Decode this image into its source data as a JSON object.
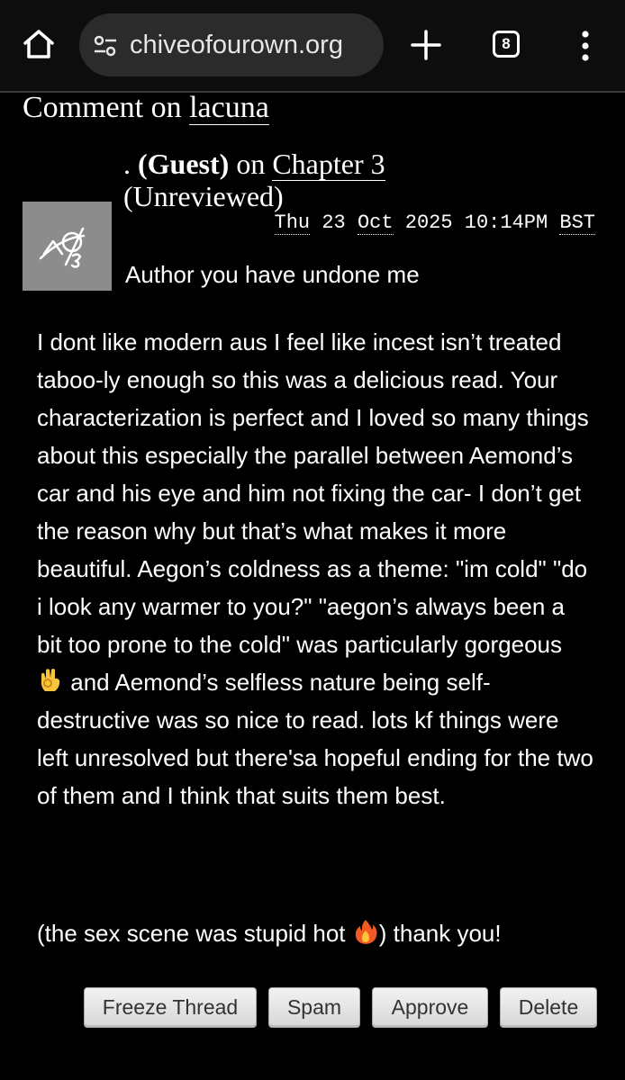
{
  "browser": {
    "url": "chiveofourown.org",
    "tab_count": "8",
    "icons": [
      "home-icon",
      "site-settings-icon",
      "new-tab-icon",
      "tab-switcher-icon",
      "more-options-icon"
    ]
  },
  "page": {
    "heading_prefix": "Comment on",
    "work_title": "lacuna"
  },
  "comment": {
    "author_prefix": ".",
    "author": "(Guest)",
    "on_text": "on",
    "chapter": "Chapter 3",
    "status": "(Unreviewed)",
    "date": {
      "day": "Thu",
      "date_num": "23",
      "month": "Oct",
      "year": "2025",
      "time": "10:14PM",
      "tz": "BST"
    },
    "first_line": "Author you have undone me",
    "body_part1": "I dont like modern aus I feel like incest isn’t treated taboo-ly enough so this was a delicious read. Your characterization is perfect and I loved so many things about this especially the parallel between Aemond’s car and his eye and him not fixing the car- I don’t get the reason why but that’s what makes it more beautiful. Aegon’s coldness as a theme: \"im cold\" \"do i look any warmer to you?\" \"aegon’s always been a bit too prone to the cold\" was particularly gorgeous",
    "body_part2": "and Aemond’s selfless nature being self-destructive was so nice to read. lots kf things were left unresolved but there'sa hopeful ending for the two of them and I think that suits them best.",
    "end_part1": "(the sex scene was stupid hot",
    "end_part2": ") thank you!"
  },
  "actions": {
    "freeze": "Freeze Thread",
    "spam": "Spam",
    "approve": "Approve",
    "delete": "Delete"
  },
  "colors": {
    "background": "#000000",
    "text": "#ffffff",
    "avatar": "#8c8c8c",
    "button_bg": "#e6e6e6",
    "button_text": "#333333"
  }
}
